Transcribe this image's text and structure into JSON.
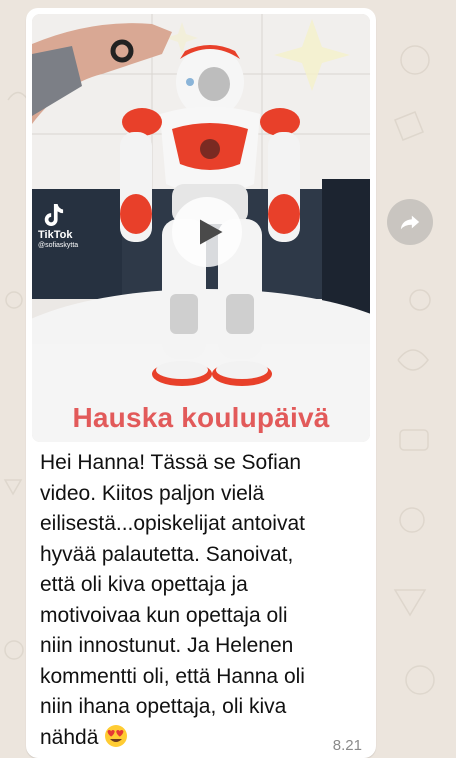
{
  "message": {
    "video": {
      "caption": "Hauska koulupäivä",
      "watermark_name": "TikTok",
      "watermark_handle": "@sofiaskytta"
    },
    "text": "Hei Hanna! Tässä se Sofian\nvideo. Kiitos paljon vielä\neilisestä...opiskelijat antoivat\nhyvää palautetta. Sanoivat,\nettä oli kiva opettaja ja\nmotivoivaa kun opettaja oli\nniin innostunut. Ja Helenen\nkommentti oli, että Hanna oli\nniin ihana opettaja, oli kiva\nnähdä",
    "emoji": "heart-eyes-emoji",
    "timestamp": "8.21"
  },
  "icons": {
    "play": "play-icon",
    "forward": "forward-icon",
    "tiktok": "tiktok-logo-icon"
  },
  "colors": {
    "wallpaper": "#ece5dd",
    "bubble": "#ffffff",
    "caption": "#e25a5a",
    "robot_accent": "#e8402a",
    "forward_button": "#c9c5c0"
  }
}
